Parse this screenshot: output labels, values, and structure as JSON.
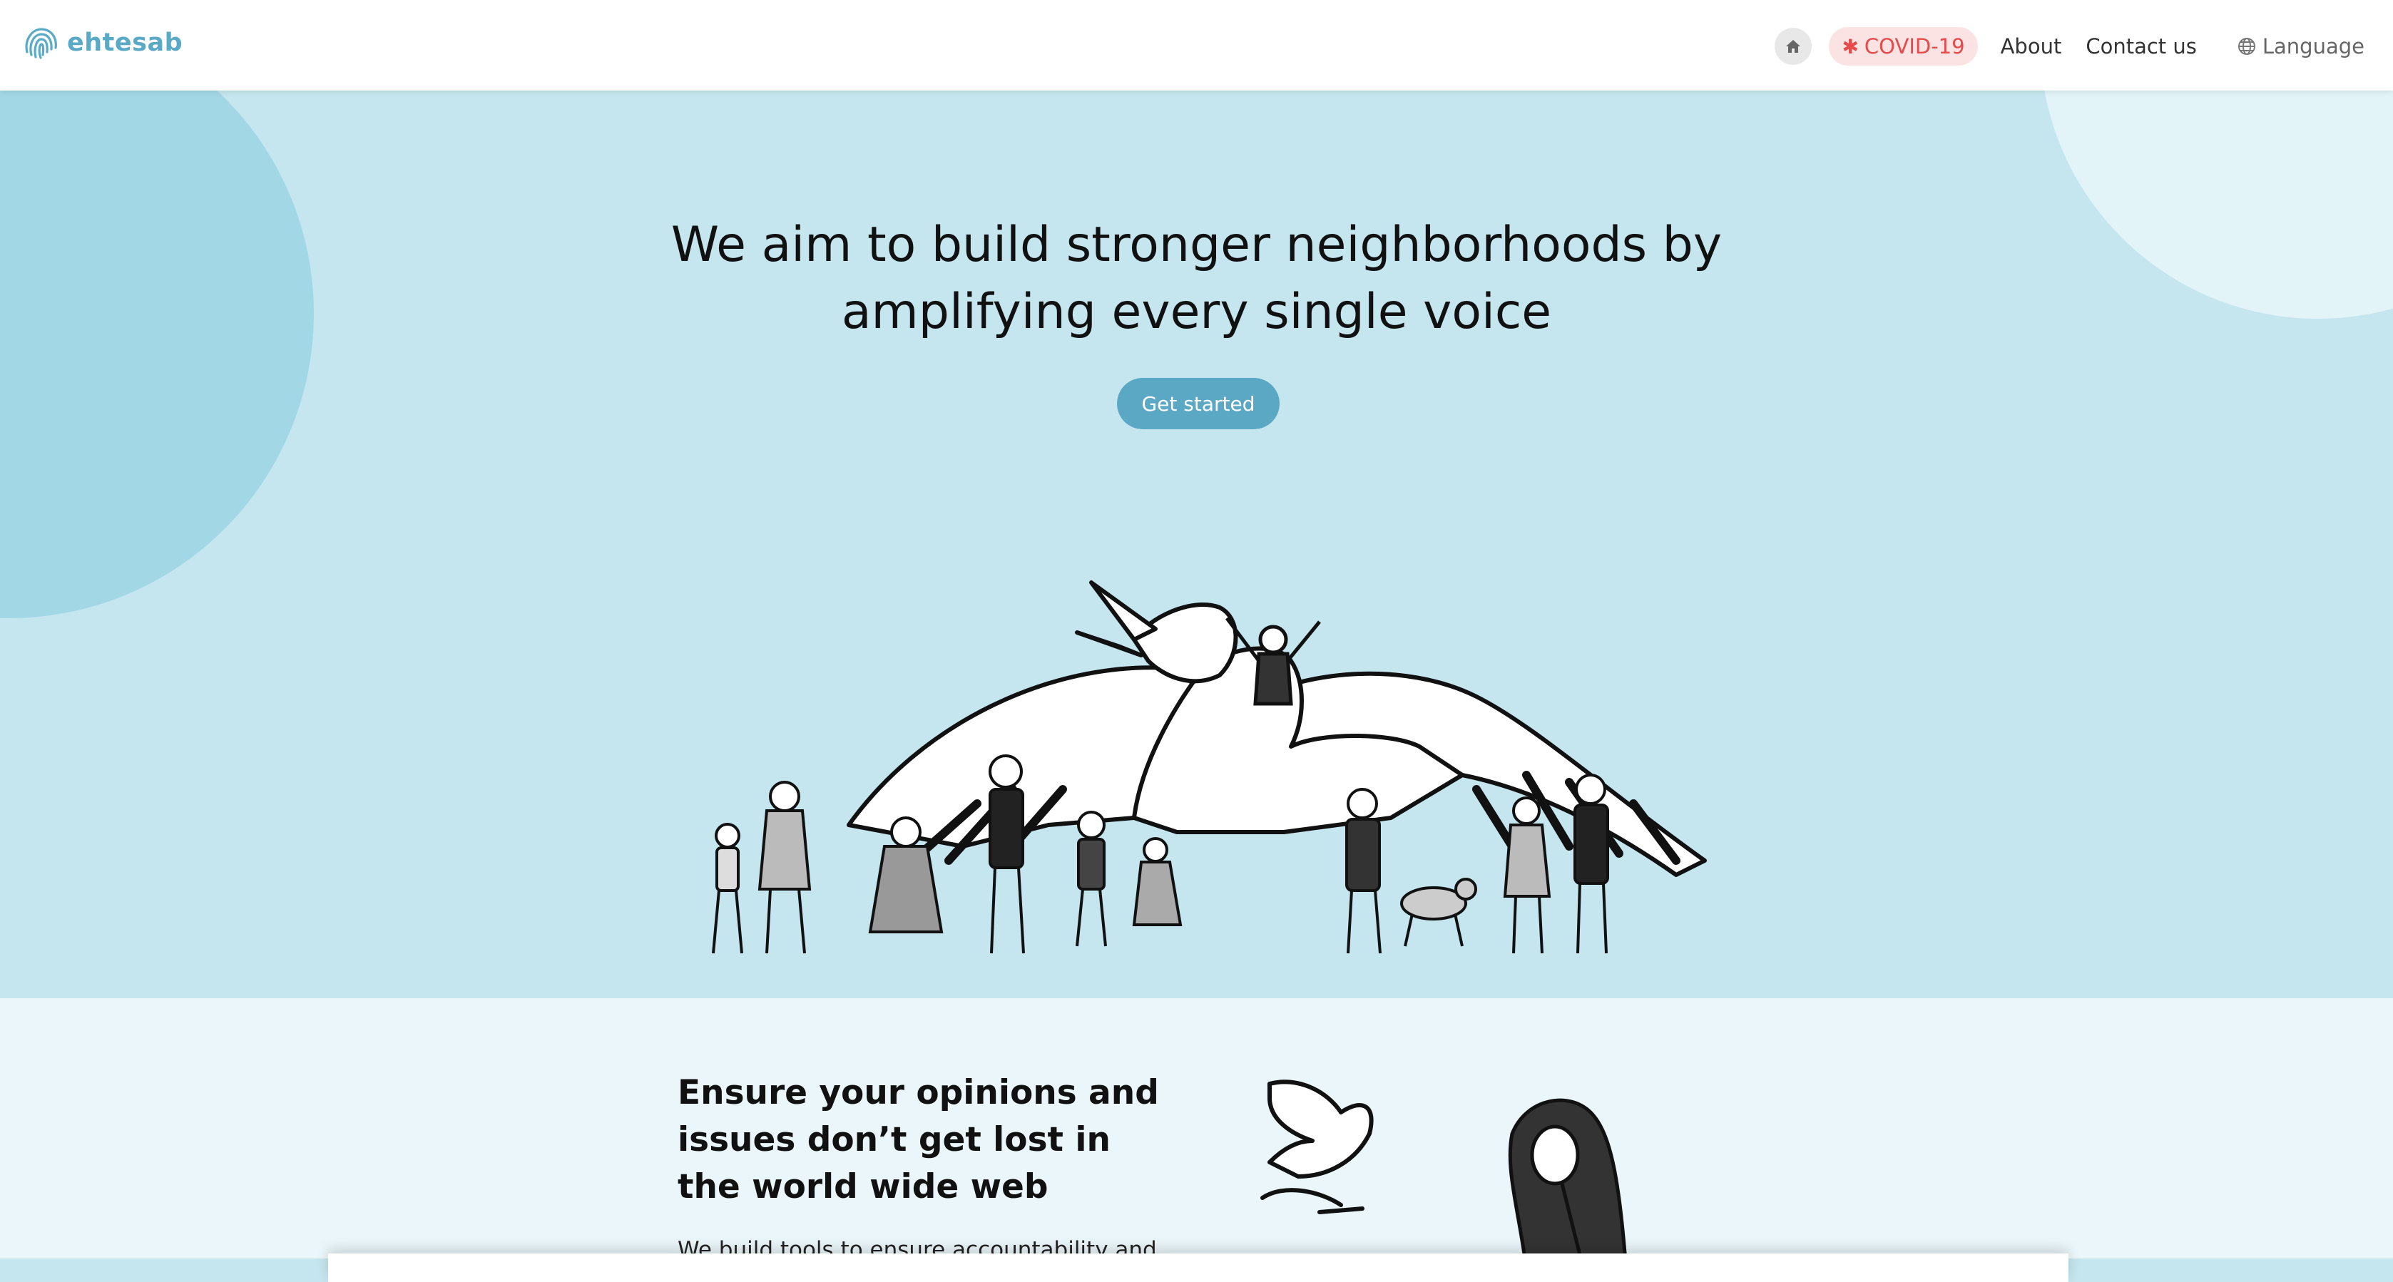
{
  "header": {
    "logo_text": "ehtesab",
    "logo_icon": "fingerprint-icon",
    "home_icon": "home-icon",
    "covid_label": "COVID-19",
    "covid_icon": "asterisk-icon",
    "about_label": "About",
    "contact_label": "Contact us",
    "language_label": "Language",
    "language_icon": "globe-icon"
  },
  "hero": {
    "title_line1": "We aim to build stronger neighborhoods by",
    "title_line2": "amplifying every single voice",
    "cta_label": "Get started"
  },
  "section2": {
    "title": "Ensure your opinions and issues don’t get lost in the world wide web",
    "text": "We build tools to ensure accountability and"
  },
  "colors": {
    "brand": "#5aaac7",
    "hero_bg": "#c5e6ef",
    "covid_text": "#e64b4b",
    "covid_bg": "#fbe3e3",
    "cta_bg": "#5ba8c5"
  }
}
